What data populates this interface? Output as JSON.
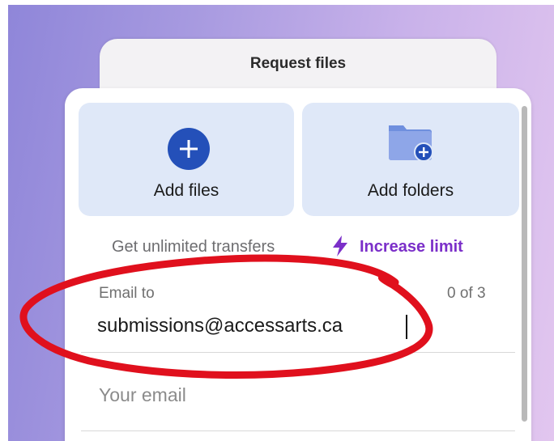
{
  "panel": {
    "title": "Request files"
  },
  "tiles": {
    "add_files_label": "Add files",
    "add_folders_label": "Add folders"
  },
  "promo": {
    "text": "Get unlimited transfers",
    "link_label": "Increase limit"
  },
  "form": {
    "email_to_label": "Email to",
    "recipient_count": "0 of 3",
    "email_to_value": "submissions@accessarts.ca",
    "your_email_placeholder": "Your email"
  },
  "colors": {
    "accent_blue": "#2450b9",
    "tile_bg": "#dfe8f8",
    "link_purple": "#7b2fc9",
    "annotation_red": "#e0101d"
  },
  "icons": {
    "add_files": "plus-circle-icon",
    "add_folders": "folder-plus-icon",
    "promo": "lightning-bolt-icon"
  }
}
